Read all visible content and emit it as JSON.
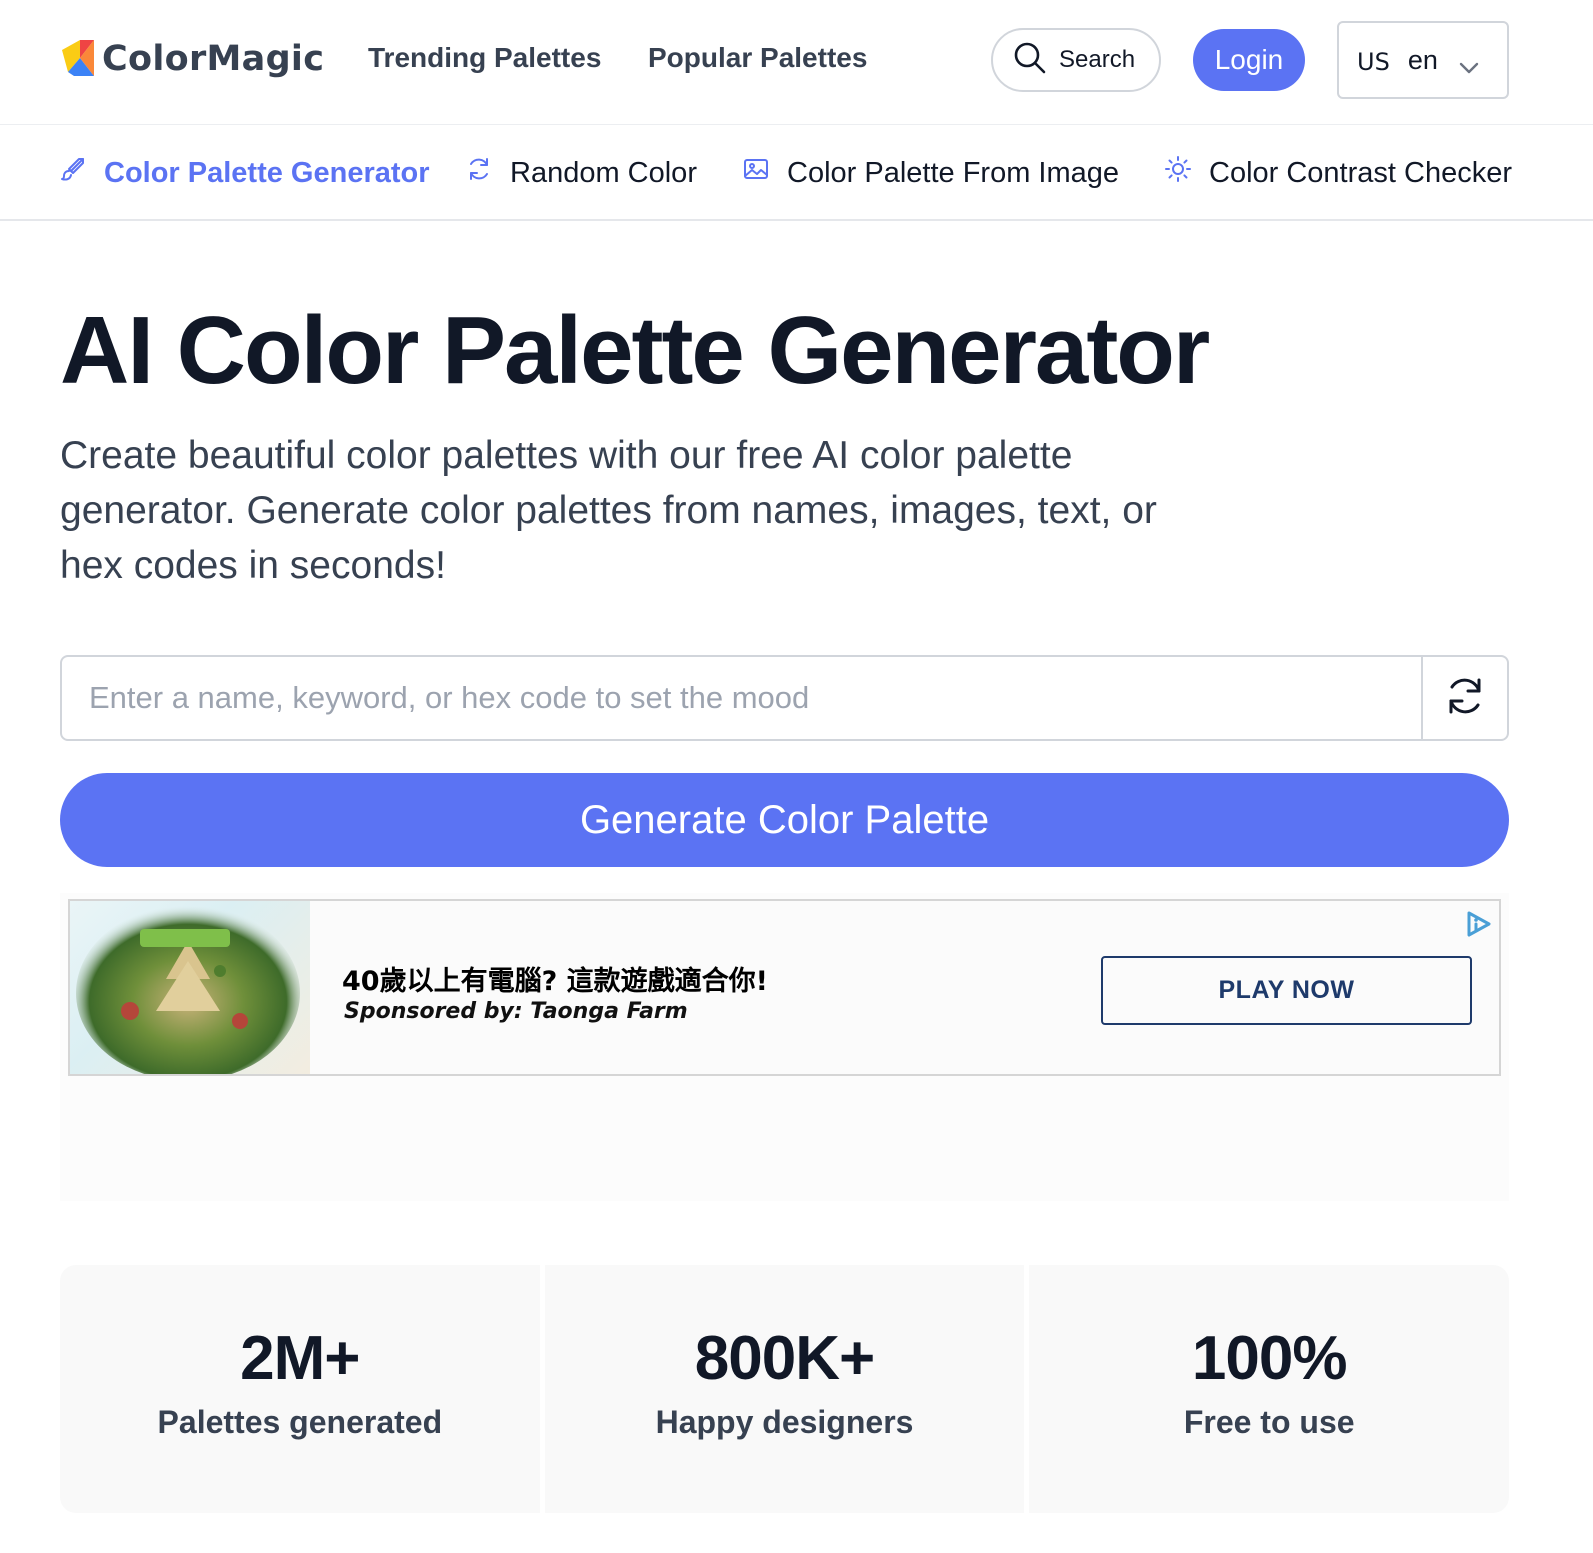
{
  "header": {
    "brand": "ColorMagic",
    "nav": [
      "Trending Palettes",
      "Popular Palettes"
    ],
    "search_label": "Search",
    "login_label": "Login",
    "language": {
      "flag": "US",
      "code": "en"
    }
  },
  "tools": [
    {
      "label": "Color Palette Generator",
      "icon": "paintbrush-icon",
      "active": true
    },
    {
      "label": "Random Color",
      "icon": "refresh-icon",
      "active": false
    },
    {
      "label": "Color Palette From Image",
      "icon": "image-icon",
      "active": false
    },
    {
      "label": "Color Contrast Checker",
      "icon": "sun-icon",
      "active": false
    }
  ],
  "hero": {
    "title": "AI Color Palette Generator",
    "subtitle": "Create beautiful color palettes with our free AI color palette generator. Generate color palettes from names, images, text, or hex codes in seconds!"
  },
  "generator": {
    "placeholder": "Enter a name, keyword, or hex code to set the mood",
    "value": "",
    "button_label": "Generate Color Palette"
  },
  "ad": {
    "headline": "40歲以上有電腦? 這款遊戲適合你!",
    "sponsor": "Sponsored by: Taonga Farm",
    "cta": "PLAY NOW"
  },
  "stats": [
    {
      "value": "2M+",
      "label": "Palettes generated"
    },
    {
      "value": "800K+",
      "label": "Happy designers"
    },
    {
      "value": "100%",
      "label": "Free to use"
    }
  ],
  "colors": {
    "accent": "#5b73f3",
    "text_dark": "#111827",
    "text_muted": "#374151",
    "ad_cta": "#1e3a6b"
  }
}
